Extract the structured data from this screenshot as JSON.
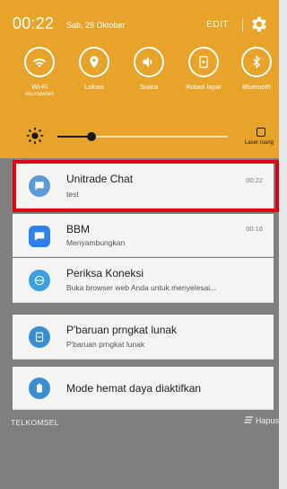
{
  "status": {
    "time": "00:22",
    "date": "Sab, 29 Oktober",
    "edit_label": "EDIT"
  },
  "toggles": [
    {
      "icon": "wifi-icon",
      "label": "Wi-Fi",
      "sub": "sto.ropolah"
    },
    {
      "icon": "location-icon",
      "label": "Lokasi",
      "sub": ""
    },
    {
      "icon": "sound-icon",
      "label": "Suara",
      "sub": ""
    },
    {
      "icon": "rotate-icon",
      "label": "Rotasi layar",
      "sub": ""
    },
    {
      "icon": "bluetooth-icon",
      "label": "Bluetooth",
      "sub": ""
    }
  ],
  "brightness": {
    "level": 0.2,
    "auto_label": "Laser ruang"
  },
  "notifications": [
    {
      "title": "Unitrade Chat",
      "text": "test",
      "time": "00:22",
      "icon_color": "#5b9bd5"
    },
    {
      "title": "BBM",
      "text": "Menyambungkan",
      "time": "00:16",
      "icon_color": "#2f80ed"
    },
    {
      "title": "Periksa Koneksi",
      "text": "Buka browser web Anda untuk menyelesai...",
      "time": "",
      "icon_color": "#3aa0e0"
    },
    {
      "title": "P'baruan prngkat lunak",
      "text": "P'baruan prngkat lunak",
      "time": "",
      "icon_color": "#3a8fd0"
    },
    {
      "title": "Mode hemat daya diaktifkan",
      "text": "",
      "time": "",
      "icon_color": "#3a8fd0"
    }
  ],
  "footer": {
    "carrier": "TELKOMSEL",
    "clear_label": "Hapus"
  },
  "colors": {
    "panel": "#e8a42a",
    "highlight": "#e00010"
  }
}
